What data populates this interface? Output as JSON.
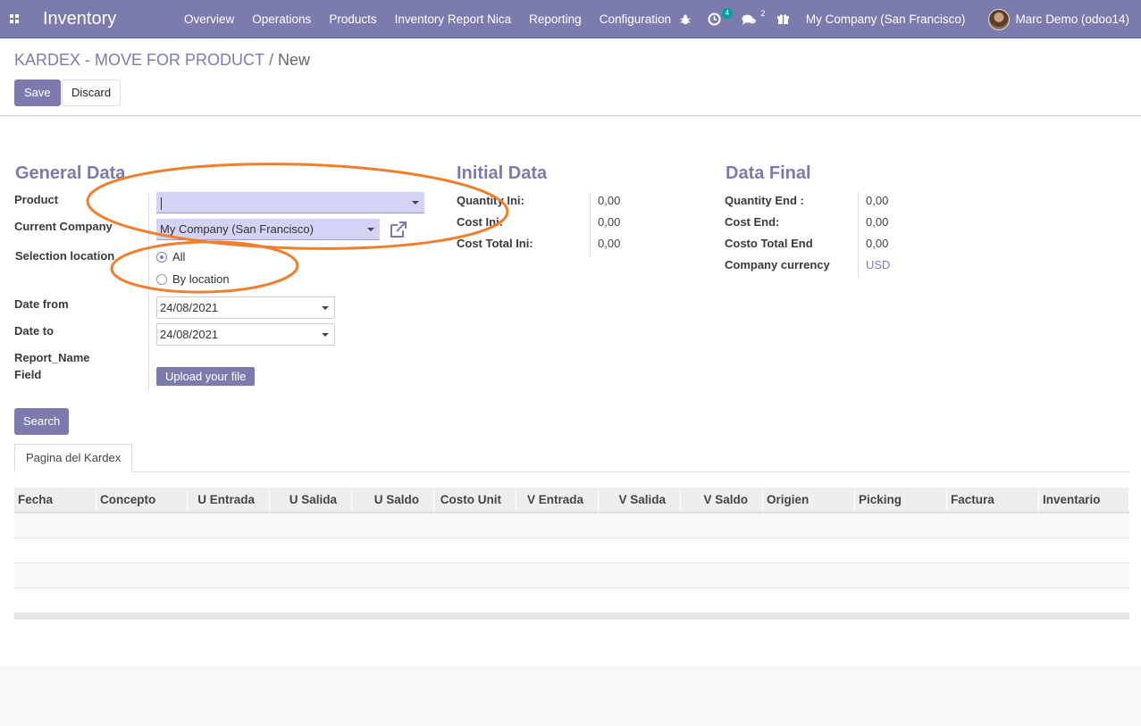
{
  "navbar": {
    "app_name": "Inventory",
    "menu": [
      "Overview",
      "Operations",
      "Products",
      "Inventory Report Nica",
      "Reporting",
      "Configuration"
    ],
    "activity_count": "4",
    "messages_count": "2",
    "company": "My Company (San Francisco)",
    "user": "Marc Demo (odoo14)"
  },
  "breadcrumb": {
    "parent": "KARDEX - MOVE FOR PRODUCT",
    "separator": "/",
    "current": "New"
  },
  "buttons": {
    "save": "Save",
    "discard": "Discard",
    "upload": "Upload your file",
    "search": "Search"
  },
  "general": {
    "title": "General Data",
    "product_label": "Product",
    "product_value": "",
    "company_label": "Current Company",
    "company_value": "My Company (San Francisco)",
    "selection_label": "Selection location",
    "radio_all": "All",
    "radio_by_location": "By location",
    "date_from_label": "Date from",
    "date_from_value": "24/08/2021",
    "date_to_label": "Date to",
    "date_to_value": "24/08/2021",
    "report_name_label_1": "Report_Name",
    "report_name_label_2": "Field"
  },
  "initial": {
    "title": "Initial Data",
    "qty_label": "Quantity Ini:",
    "qty_value": "0,00",
    "cost_label": "Cost Ini:",
    "cost_value": "0,00",
    "total_label": "Cost Total Ini:",
    "total_value": "0,00"
  },
  "final": {
    "title": "Data Final",
    "qty_label": "Quantity End :",
    "qty_value": "0,00",
    "cost_label": "Cost End:",
    "cost_value": "0,00",
    "total_label": "Costo Total End",
    "total_value": "0,00",
    "currency_label": "Company currency",
    "currency_value": "USD"
  },
  "tabs": [
    "Pagina del Kardex"
  ],
  "table": {
    "columns": [
      "Fecha",
      "Concepto",
      "U Entrada",
      "U Salida",
      "U Saldo",
      "Costo Unit",
      "V Entrada",
      "V Salida",
      "V Saldo",
      "Origien",
      "Picking",
      "Factura",
      "Inventario"
    ]
  },
  "colors": {
    "brand": "#7c7bad",
    "annotation": "#f07f2d"
  }
}
